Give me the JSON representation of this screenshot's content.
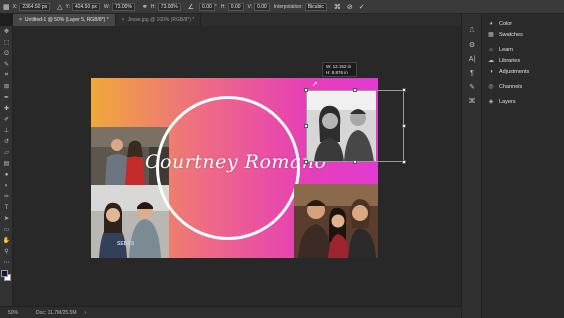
{
  "options": {
    "x_label": "X:",
    "x_value": "2364.50 px",
    "y_label": "Y:",
    "y_value": "424.50 px",
    "w_label": "W:",
    "w_value": "73.00%",
    "h_label": "H:",
    "h_value": "73.00%",
    "angle_value": "0.00",
    "hskew_label": "H:",
    "hskew_value": "0.00",
    "vskew_label": "V:",
    "vskew_value": "0.00",
    "interp_label": "Interpolation:",
    "interp_value": "Bicubic"
  },
  "tabs": [
    {
      "label": "Untitled-1 @ 50% (Layer 5, RGB/8*) *",
      "active": true
    },
    {
      "label": "Jesse.jpg @ 100% (RGB/8*) *",
      "active": false
    }
  ],
  "canvas": {
    "title_text": "Courtney Romano",
    "tooltip_w": "W: 12.153 in",
    "tooltip_h": "H: 8.876 in"
  },
  "status": {
    "zoom": "50%",
    "doc": "Doc: 11.7M/25.5M"
  },
  "panels": [
    {
      "label": "Color",
      "icon": "color-wheel-icon"
    },
    {
      "label": "Swatches",
      "icon": "swatches-grid-icon"
    },
    {
      "label": "Learn",
      "icon": "lightbulb-icon"
    },
    {
      "label": "Libraries",
      "icon": "libraries-cloud-icon"
    },
    {
      "label": "Adjustments",
      "icon": "adjustments-circle-icon"
    },
    {
      "label": "Channels",
      "icon": "channels-icon"
    },
    {
      "label": "Layers",
      "icon": "layers-stack-icon"
    }
  ],
  "colors": {
    "foreground": "#0a1a4a",
    "background": "#ffffff",
    "gradient_start": "#f0a93a",
    "gradient_end": "#e23ad2"
  }
}
